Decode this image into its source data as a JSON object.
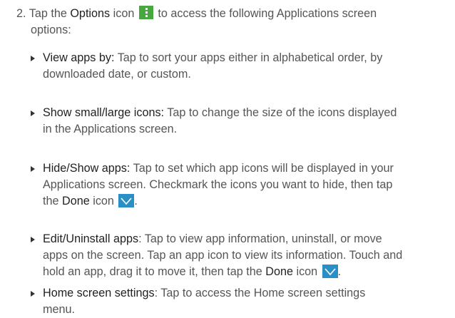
{
  "step": {
    "number": "2.",
    "text_a": "Tap the ",
    "options_word": "Options",
    "text_b": " icon ",
    "text_c": " to access the following Applications screen",
    "text_d": "options:",
    "options_icon": "options-menu-icon",
    "options_icon_color": "#46a83f"
  },
  "options": [
    {
      "title": "View apps by:",
      "line1": " Tap to sort your apps either in alphabetical order, by",
      "line2": "downloaded date, or custom."
    },
    {
      "title": "Show small/large icons:",
      "line1": " Tap to change the size of the icons displayed",
      "line2": "in the Applications screen."
    },
    {
      "title": "Hide/Show apps:",
      "line1": " Tap to set which app icons will be displayed in your",
      "line2": "Applications screen. Checkmark the icons you want to hide, then tap",
      "line3a": "the ",
      "done_word": "Done",
      "line3b": " icon ",
      "line3c": "."
    },
    {
      "title": "Edit/Uninstall apps",
      "line1": ": Tap to view app information, uninstall, or move",
      "line2": "apps on the screen. Tap an app icon to view its information. Touch and",
      "line3a": "hold an app, drag it to move it, then tap the ",
      "done_word": "Done",
      "line3b": " icon ",
      "line3c": "."
    },
    {
      "title": "Home screen settings",
      "line1": ": Tap to access the Home screen settings",
      "line2": "menu."
    }
  ],
  "done_icon": "checkmark-done-icon",
  "done_icon_color": "#2a8fc6"
}
